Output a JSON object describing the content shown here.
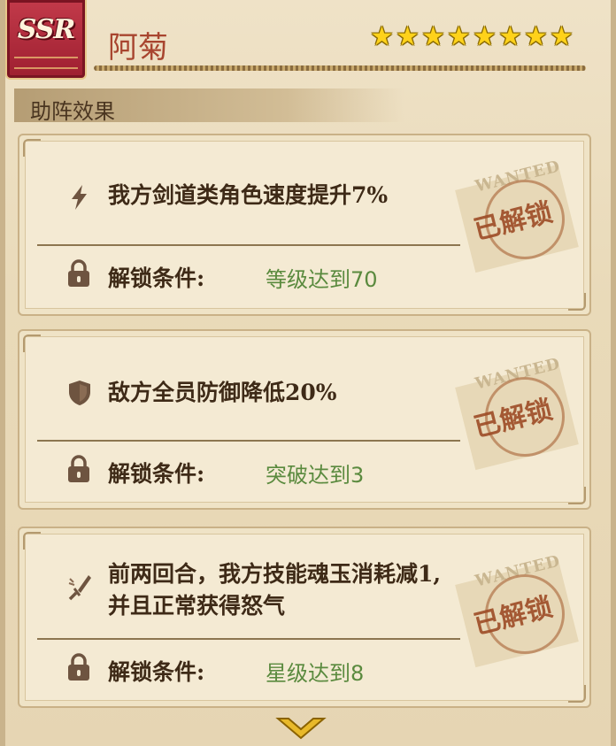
{
  "header": {
    "rarity_badge": "SSR",
    "character_name": "阿菊",
    "star_count": 8,
    "star_glyph": "★"
  },
  "section": {
    "title": "助阵效果"
  },
  "effects": [
    {
      "icon": "lightning-icon",
      "text": "我方剑道类角色速度提升7%",
      "condition_label": "解锁条件:",
      "condition_value": "等级达到70",
      "stamp": "已解锁",
      "stamp_watermark": "WANTED"
    },
    {
      "icon": "shield-icon",
      "text": "敌方全员防御降低20%",
      "condition_label": "解锁条件:",
      "condition_value": "突破达到3",
      "stamp": "已解锁",
      "stamp_watermark": "WANTED"
    },
    {
      "icon": "sword-icon",
      "text_line1": "前两回合，我方技能魂玉消耗减1,",
      "text_line2": "并且正常获得怒气",
      "condition_label": "解锁条件:",
      "condition_value": "星级达到8",
      "stamp": "已解锁",
      "stamp_watermark": "WANTED"
    }
  ],
  "colors": {
    "name": "#a8452f",
    "condition_value": "#5a8a3e",
    "stamp": "#9d4c26",
    "star": "#ffd21a",
    "badge": "#b02a3b"
  }
}
